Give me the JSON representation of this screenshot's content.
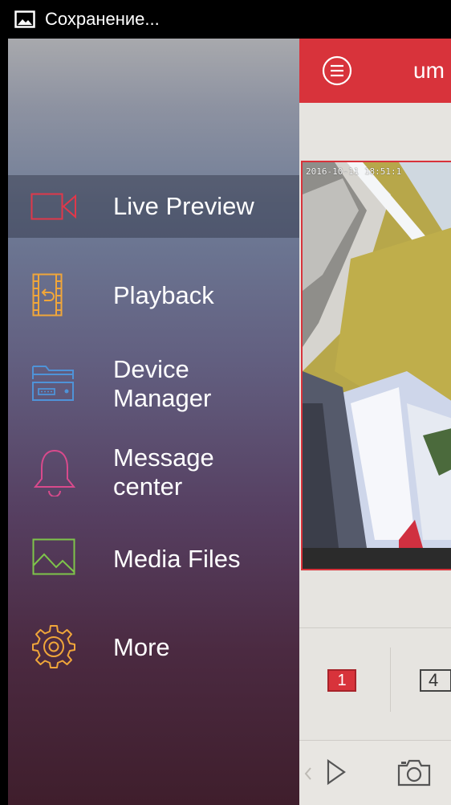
{
  "status_bar": {
    "icon": "image-icon",
    "text": "Сохранение..."
  },
  "drawer": {
    "items": [
      {
        "label": "Live Preview",
        "icon": "video-camera-icon",
        "icon_color": "#e0384a",
        "selected": true
      },
      {
        "label": "Playback",
        "icon": "film-playback-icon",
        "icon_color": "#f0a63a",
        "selected": false
      },
      {
        "label": "Device\nManager",
        "icon": "device-recorder-icon",
        "icon_color": "#4f93d8",
        "selected": false
      },
      {
        "label": "Message\ncenter",
        "icon": "bell-icon",
        "icon_color": "#d84a8c",
        "selected": false
      },
      {
        "label": "Media Files",
        "icon": "image-landscape-icon",
        "icon_color": "#7ec44a",
        "selected": false
      },
      {
        "label": "More",
        "icon": "gear-icon",
        "icon_color": "#f0a63a",
        "selected": false
      }
    ]
  },
  "app": {
    "header_title": "um",
    "header_color": "#d8333b",
    "video": {
      "timestamp": "2016-10-11 18:51:1"
    },
    "split_buttons": [
      "1",
      "4"
    ],
    "toolbar": {
      "left_icon": "chevron-left-icon",
      "play_icon": "play-icon",
      "camera_icon": "camera-icon"
    }
  }
}
